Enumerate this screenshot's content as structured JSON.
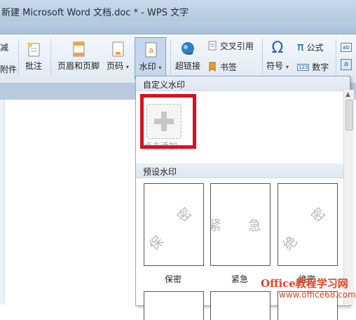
{
  "window": {
    "title": "新建 Microsoft Word 文档.doc * - WPS 文字"
  },
  "ribbon": {
    "partial_left_top": "减",
    "partial_left_bottom": "附件",
    "comment": "批注",
    "header_footer": "页眉和页脚",
    "page_number": "页码",
    "watermark": "水印",
    "hyperlink": "超链接",
    "cross_ref": "交叉引用",
    "bookmark": "书签",
    "symbol": "符号",
    "formula": "公式",
    "number": "数字"
  },
  "watermark_menu": {
    "custom_section": "自定义水印",
    "add_label": "点击添加",
    "preset_section": "预设水印",
    "presets": [
      {
        "label": "保密",
        "watermark": "保 密"
      },
      {
        "label": "紧急",
        "watermark": "紧 急"
      },
      {
        "label": "绝密",
        "watermark": "绝 密"
      }
    ]
  },
  "site_watermark": {
    "brand": "Office教程学习网",
    "url": "www.office68.com"
  },
  "colors": {
    "highlight": "#d5121f",
    "ribbon": "#dfe8f2",
    "brand": "#e8431f"
  }
}
